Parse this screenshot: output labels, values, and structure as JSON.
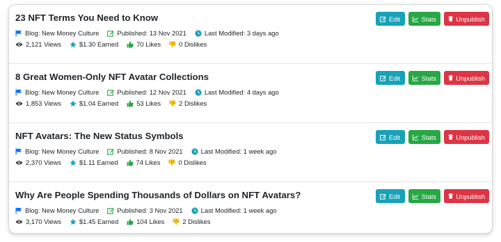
{
  "buttons": {
    "edit": "Edit",
    "stats": "Stats",
    "unpublish": "Unpublish"
  },
  "posts": [
    {
      "title": "23 NFT Terms You Need to Know",
      "blog": "Blog: New Money Culture",
      "published": "Published: 13 Nov 2021",
      "modified": "Last Modified: 3 days ago",
      "views": "2,121 Views",
      "earned": "$1.30 Earned",
      "likes": "70 Likes",
      "dislikes": "0 Dislikes"
    },
    {
      "title": "8 Great Women-Only NFT Avatar Collections",
      "blog": "Blog: New Money Culture",
      "published": "Published: 12 Nov 2021",
      "modified": "Last Modified: 4 days ago",
      "views": "1,853 Views",
      "earned": "$1.04 Earned",
      "likes": "53 Likes",
      "dislikes": "2 Dislikes"
    },
    {
      "title": "NFT Avatars: The New Status Symbols",
      "blog": "Blog: New Money Culture",
      "published": "Published: 8 Nov 2021",
      "modified": "Last Modified: 1 week ago",
      "views": "2,370 Views",
      "earned": "$1.11 Earned",
      "likes": "74 Likes",
      "dislikes": "0 Dislikes"
    },
    {
      "title": "Why Are People Spending Thousands of Dollars on NFT Avatars?",
      "blog": "Blog: New Money Culture",
      "published": "Published: 3 Nov 2021",
      "modified": "Last Modified: 1 week ago",
      "views": "3,170 Views",
      "earned": "$1.45 Earned",
      "likes": "104 Likes",
      "dislikes": "2 Dislikes"
    }
  ],
  "colors": {
    "edit": "#17a2b8",
    "stats": "#28a745",
    "unpublish": "#dc3545",
    "flag": "#0d6efd",
    "published": "#28a745",
    "modified": "#17a2b8",
    "earned": "#17a2b8",
    "likes": "#28a745",
    "dislikes": "#f0b400"
  },
  "icons": {
    "blog": "flag-icon",
    "published": "edit-square-icon",
    "modified": "clock-icon",
    "views": "eye-icon",
    "earned": "star-icon",
    "likes": "thumbs-up-icon",
    "dislikes": "thumbs-down-icon",
    "edit": "edit-square-icon",
    "stats": "line-chart-icon",
    "unpublish": "trash-icon"
  }
}
